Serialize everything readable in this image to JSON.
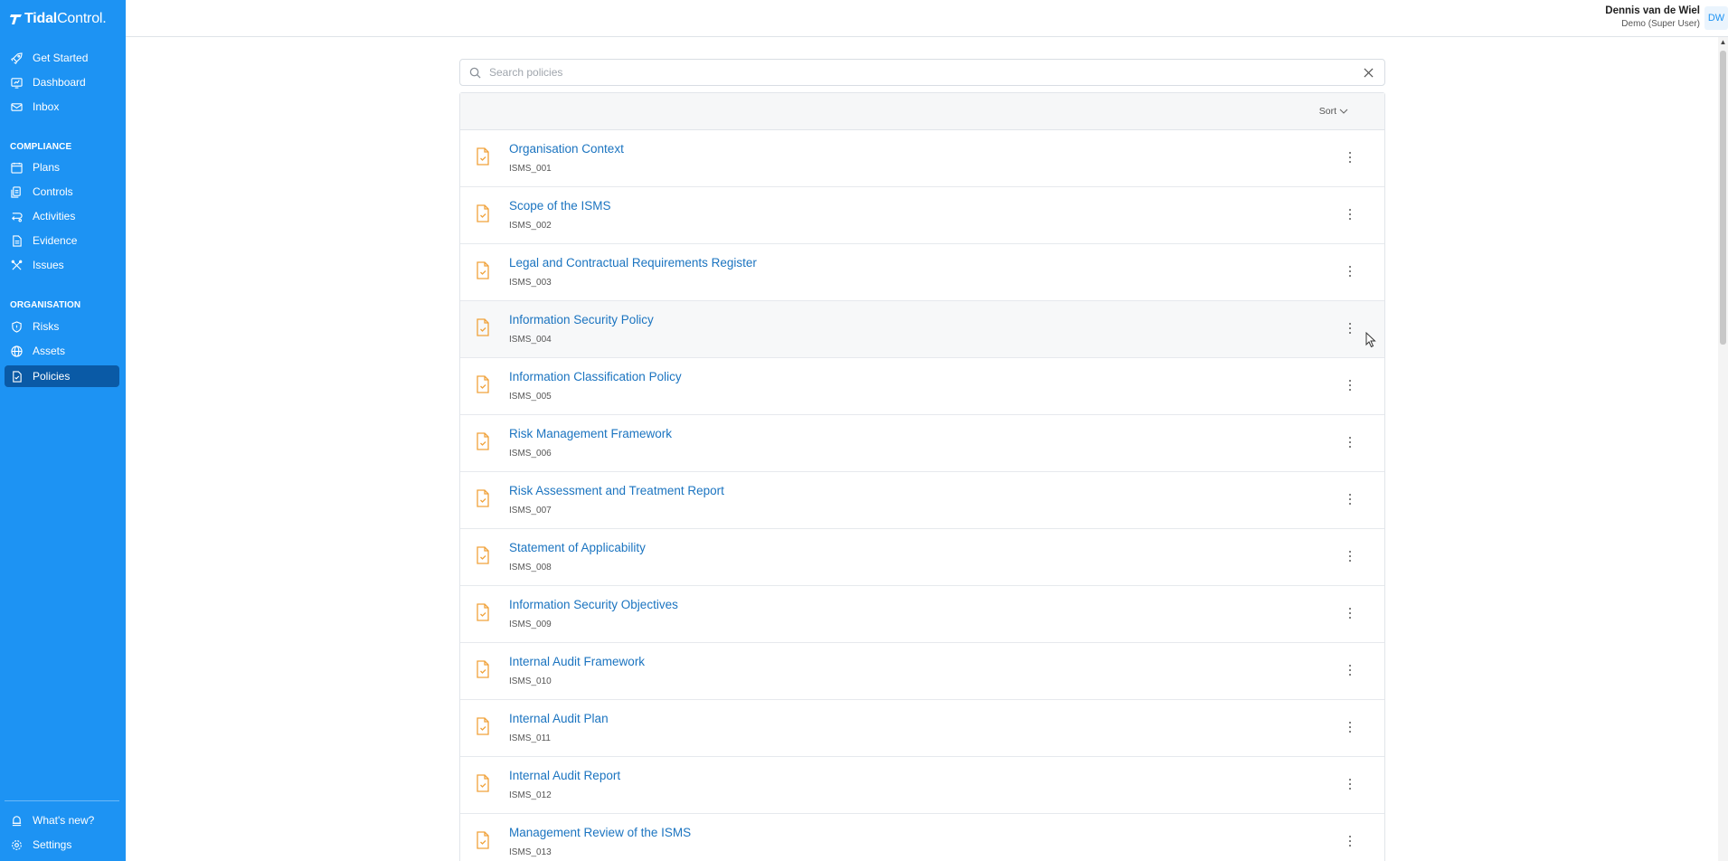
{
  "app": {
    "logo_bold": "Tidal",
    "logo_light": "Control."
  },
  "sidebar": {
    "top_items": [
      {
        "label": "Get Started",
        "icon": "rocket-icon"
      },
      {
        "label": "Dashboard",
        "icon": "dashboard-icon"
      },
      {
        "label": "Inbox",
        "icon": "mail-icon"
      }
    ],
    "compliance_heading": "COMPLIANCE",
    "compliance_items": [
      {
        "label": "Plans",
        "icon": "calendar-icon"
      },
      {
        "label": "Controls",
        "icon": "controls-icon"
      },
      {
        "label": "Activities",
        "icon": "activities-icon"
      },
      {
        "label": "Evidence",
        "icon": "document-icon"
      },
      {
        "label": "Issues",
        "icon": "tools-icon"
      }
    ],
    "organisation_heading": "ORGANISATION",
    "organisation_items": [
      {
        "label": "Risks",
        "icon": "shield-icon"
      },
      {
        "label": "Assets",
        "icon": "globe-icon"
      },
      {
        "label": "Policies",
        "icon": "policy-icon",
        "active": true
      }
    ],
    "bottom_items": [
      {
        "label": "What's new?",
        "icon": "bell-icon"
      },
      {
        "label": "Settings",
        "icon": "gear-icon"
      }
    ]
  },
  "header": {
    "user_name": "Dennis van de Wiel",
    "user_role": "Demo (Super User)",
    "avatar_initials": "DW"
  },
  "search": {
    "placeholder": "Search policies",
    "value": ""
  },
  "list": {
    "sort_label": "Sort",
    "policies": [
      {
        "title": "Organisation Context",
        "code": "ISMS_001"
      },
      {
        "title": "Scope of the ISMS",
        "code": "ISMS_002"
      },
      {
        "title": "Legal and Contractual Requirements Register",
        "code": "ISMS_003"
      },
      {
        "title": "Information Security Policy",
        "code": "ISMS_004"
      },
      {
        "title": "Information Classification Policy",
        "code": "ISMS_005"
      },
      {
        "title": "Risk Management Framework",
        "code": "ISMS_006"
      },
      {
        "title": "Risk Assessment and Treatment Report",
        "code": "ISMS_007"
      },
      {
        "title": "Statement of Applicability",
        "code": "ISMS_008"
      },
      {
        "title": "Information Security Objectives",
        "code": "ISMS_009"
      },
      {
        "title": "Internal Audit Framework",
        "code": "ISMS_010"
      },
      {
        "title": "Internal Audit Plan",
        "code": "ISMS_011"
      },
      {
        "title": "Internal Audit Report",
        "code": "ISMS_012"
      },
      {
        "title": "Management Review of the ISMS",
        "code": "ISMS_013"
      }
    ]
  },
  "colors": {
    "sidebar_bg": "#1d93f3",
    "sidebar_active": "#0a5aa6",
    "link": "#1b74c0",
    "policy_icon": "#f0a23a"
  }
}
